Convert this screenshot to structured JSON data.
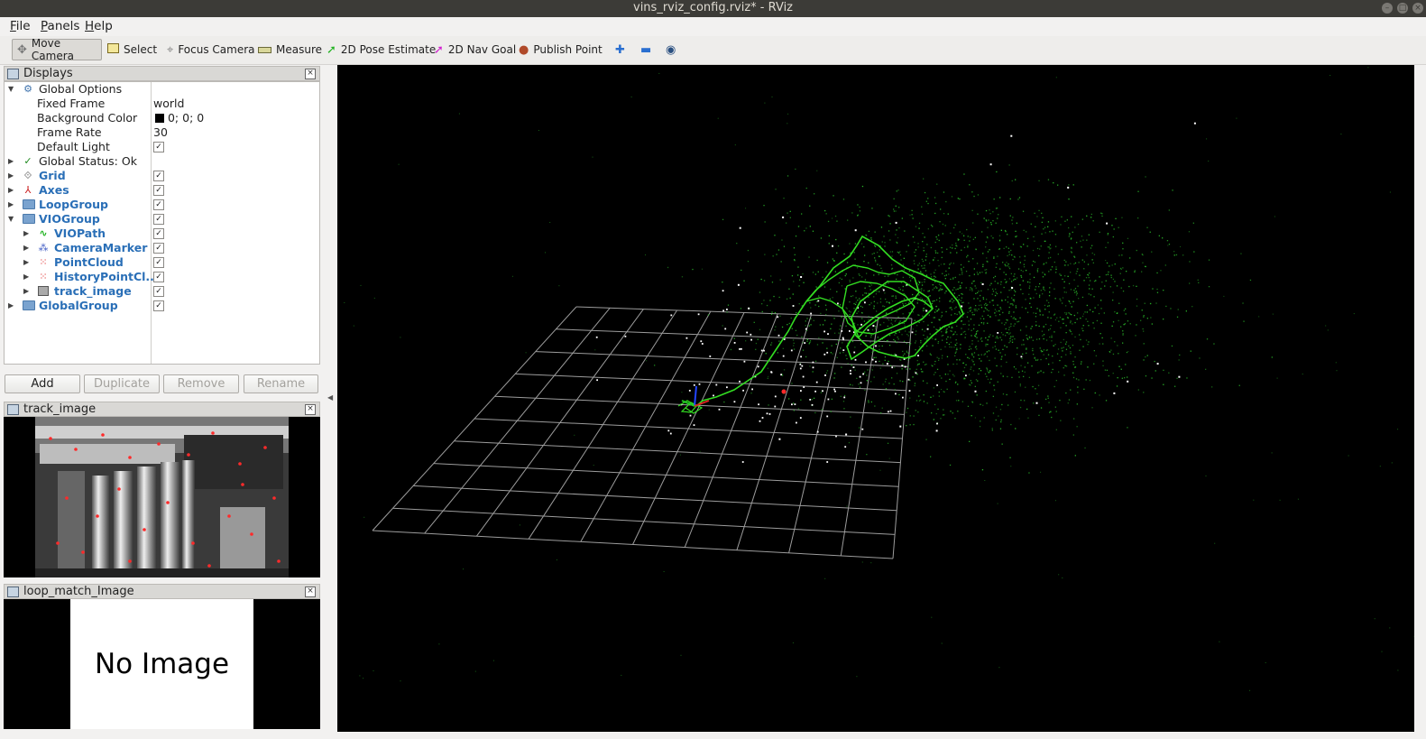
{
  "window": {
    "title": "vins_rviz_config.rviz* - RViz"
  },
  "menu": [
    {
      "label": "File",
      "accel": "F",
      "rest": "ile"
    },
    {
      "label": "Panels",
      "accel": "P",
      "rest": "anels"
    },
    {
      "label": "Help",
      "accel": "H",
      "rest": "elp"
    }
  ],
  "toolbar": {
    "tools": [
      "Move Camera",
      "Select",
      "Focus Camera",
      "Measure",
      "2D Pose Estimate",
      "2D Nav Goal",
      "Publish Point"
    ]
  },
  "displays": {
    "title": "Displays",
    "global_options": "Global Options",
    "props": [
      {
        "name": "Fixed Frame",
        "value": "world"
      },
      {
        "name": "Background Color",
        "value": "0; 0; 0",
        "swatch": "#000000"
      },
      {
        "name": "Frame Rate",
        "value": "30"
      },
      {
        "name": "Default Light",
        "checked": true
      }
    ],
    "global_status": "Global Status: Ok",
    "items": [
      {
        "name": "Grid",
        "checked": true
      },
      {
        "name": "Axes",
        "checked": true
      },
      {
        "name": "LoopGroup",
        "checked": true
      },
      {
        "name": "VIOGroup",
        "checked": true
      },
      {
        "name": "VIOPath",
        "checked": true
      },
      {
        "name": "CameraMarker",
        "checked": true
      },
      {
        "name": "PointCloud",
        "checked": true
      },
      {
        "name": "HistoryPointCl...",
        "checked": true
      },
      {
        "name": "track_image",
        "checked": true
      },
      {
        "name": "GlobalGroup",
        "checked": true
      }
    ],
    "buttons": {
      "add": "Add",
      "duplicate": "Duplicate",
      "remove": "Remove",
      "rename": "Rename"
    }
  },
  "track_panel": {
    "title": "track_image"
  },
  "loop_panel": {
    "title": "loop_match_Image",
    "placeholder": "No Image"
  },
  "colors": {
    "path": "#33dd22",
    "points": "#2bbf2b",
    "grid": "#a0a0a0",
    "link": "#2a6fb7"
  }
}
